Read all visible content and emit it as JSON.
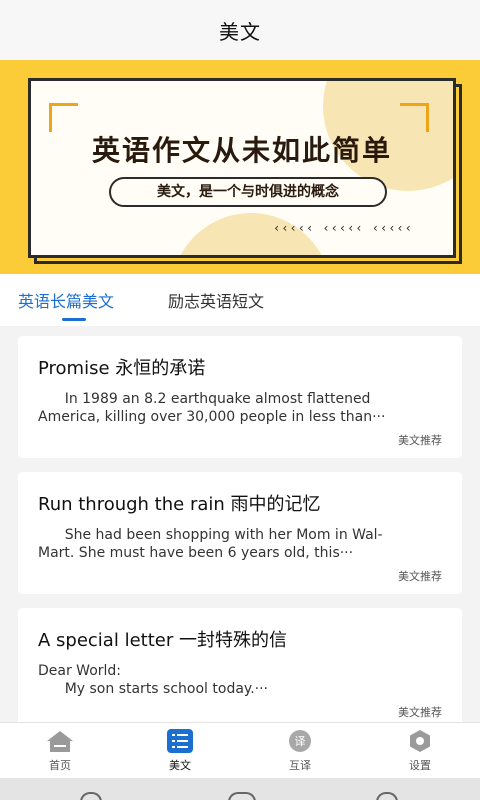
{
  "header": {
    "title": "美文"
  },
  "banner": {
    "headline": "英语作文从未如此简单",
    "tagline": "美文，是一个与时俱进的概念",
    "chevrons": "‹‹‹‹‹  ‹‹‹‹‹  ‹‹‹‹‹"
  },
  "tabs": [
    {
      "label": "英语长篇美文"
    },
    {
      "label": "励志英语短文"
    }
  ],
  "articles": [
    {
      "title": "Promise 永恒的承诺",
      "line1": "      In 1989 an 8.2 earthquake almost flattened",
      "line2": "America, killing over 30,000 people in less than···",
      "tag": "美文推荐"
    },
    {
      "title": "Run through the rain 雨中的记忆",
      "line1": "      She had been shopping with her Mom in Wal-",
      "line2": "Mart. She must have been 6 years old, this···",
      "tag": "美文推荐"
    },
    {
      "title": "A special letter 一封特殊的信",
      "line1": "Dear World:",
      "line2": "      My son starts school today.···",
      "tag": "美文推荐"
    }
  ],
  "nav": [
    {
      "label": "首页",
      "icon": "home-icon"
    },
    {
      "label": "美文",
      "icon": "article-list-icon"
    },
    {
      "label": "互译",
      "icon": "translate-icon"
    },
    {
      "label": "设置",
      "icon": "settings-icon"
    }
  ],
  "colors": {
    "accent": "#1b6fd0",
    "banner_bg": "#fbcc38",
    "corner": "#f0a417"
  }
}
